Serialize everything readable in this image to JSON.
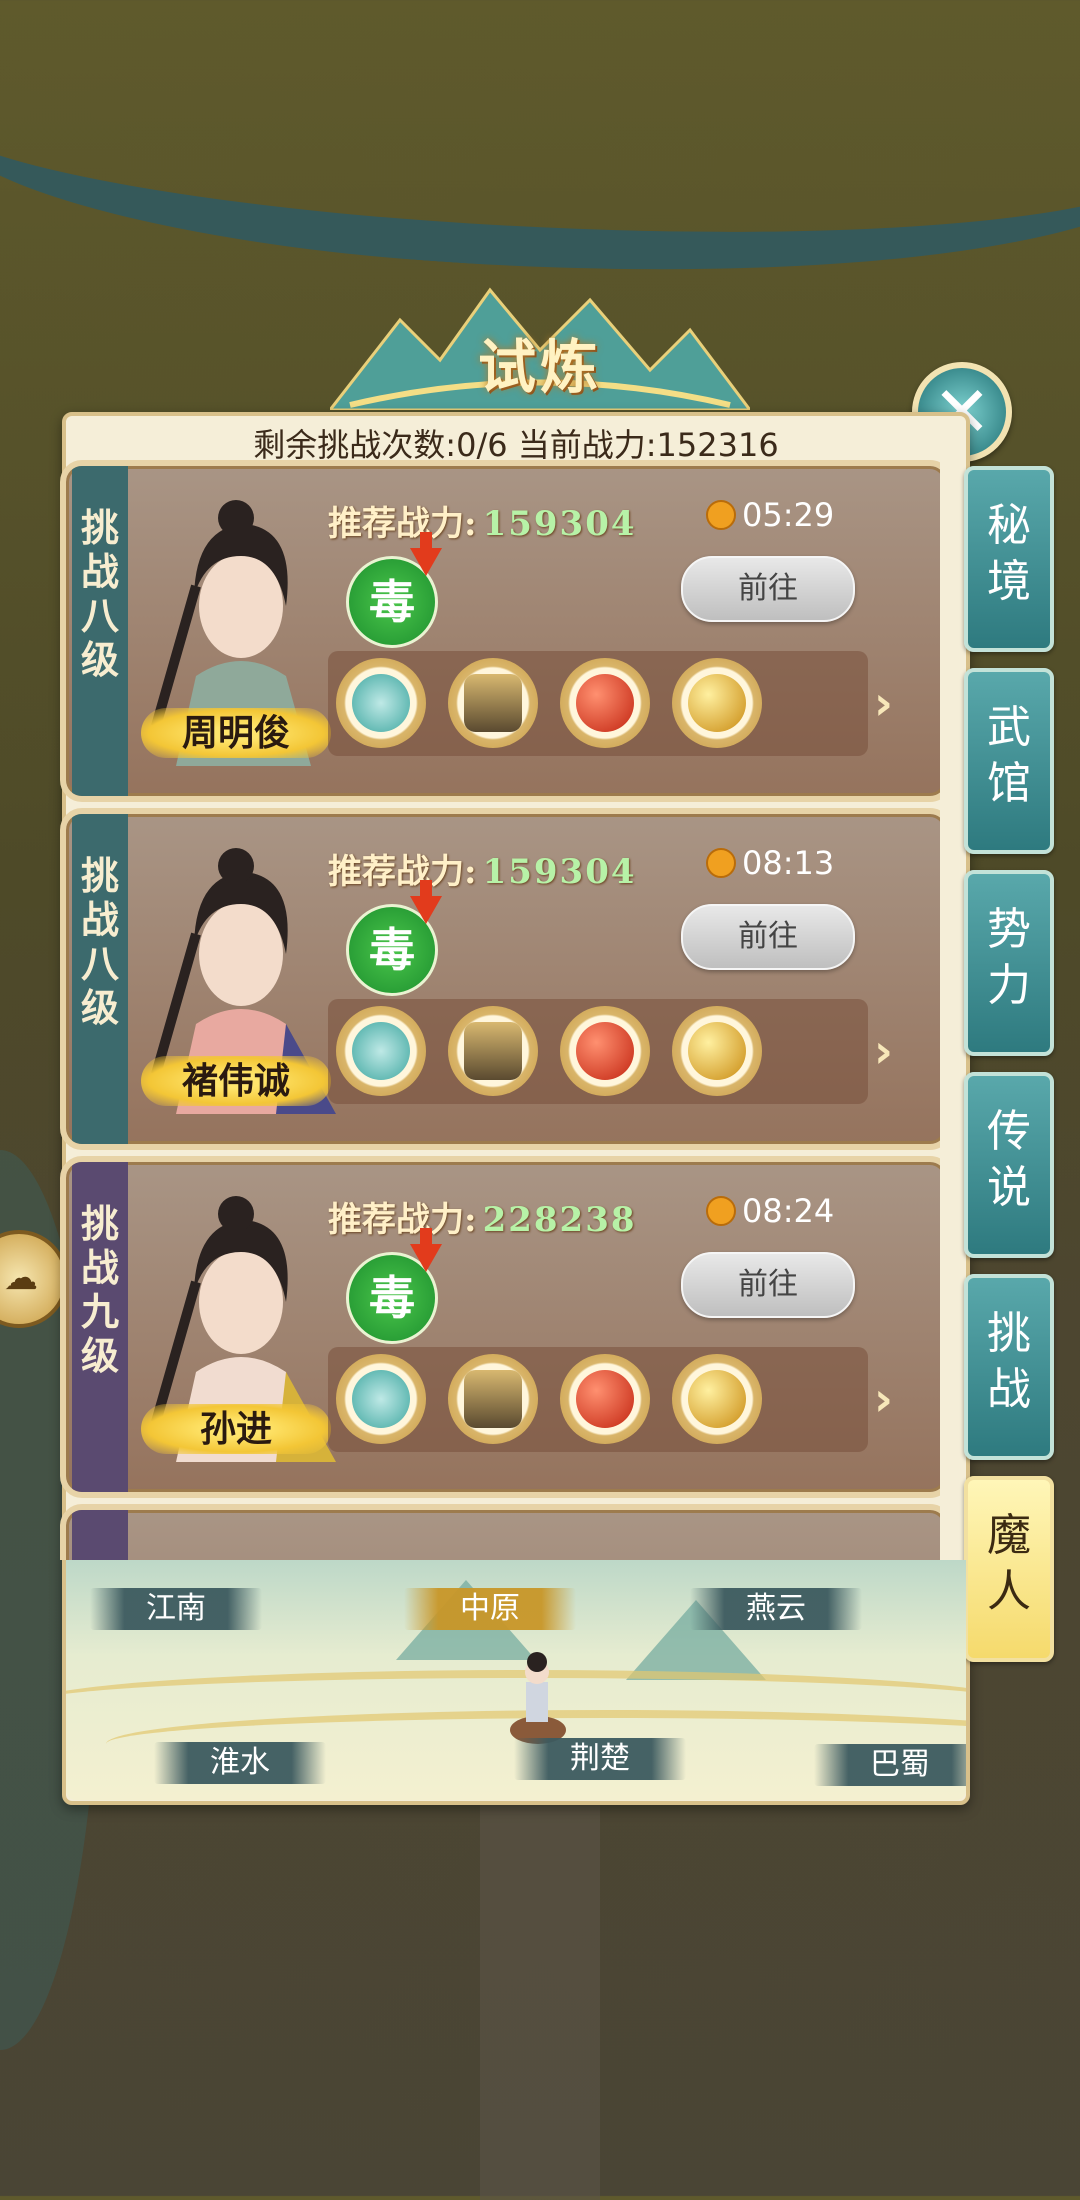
{
  "header": {
    "title": "试炼",
    "status": "剩余挑战次数:0/6 当前战力:152316"
  },
  "cards": [
    {
      "tier": "挑战八级",
      "name": "周明俊",
      "rec_label": "推荐战力:",
      "rec_value": "159304",
      "timer": "05:29",
      "element": "毒",
      "button": "前往",
      "theme": "teal"
    },
    {
      "tier": "挑战八级",
      "name": "褚伟诚",
      "rec_label": "推荐战力:",
      "rec_value": "159304",
      "timer": "08:13",
      "element": "毒",
      "button": "前往",
      "theme": "teal"
    },
    {
      "tier": "挑战九级",
      "name": "孙进",
      "rec_label": "推荐战力:",
      "rec_value": "228238",
      "timer": "08:24",
      "element": "毒",
      "button": "前往",
      "theme": "purple"
    }
  ],
  "rewards": [
    "herb-icon",
    "rock-icon",
    "red-orb-icon",
    "gold-orb-icon"
  ],
  "tabs": [
    {
      "label": "秘境",
      "active": false
    },
    {
      "label": "武馆",
      "active": false
    },
    {
      "label": "势力",
      "active": false
    },
    {
      "label": "传说",
      "active": false
    },
    {
      "label": "挑战",
      "active": false
    },
    {
      "label": "魔人",
      "active": true
    }
  ],
  "regions": {
    "r1": "江南",
    "r2": "中原",
    "r3": "燕云",
    "r4": "淮水",
    "r5": "荆楚",
    "r6": "巴蜀",
    "selected": "中原"
  },
  "colors": {
    "accent_teal": "#3c8d8f",
    "recommend_value": "#b7f2a7",
    "active_tab": "#f5da6c"
  }
}
